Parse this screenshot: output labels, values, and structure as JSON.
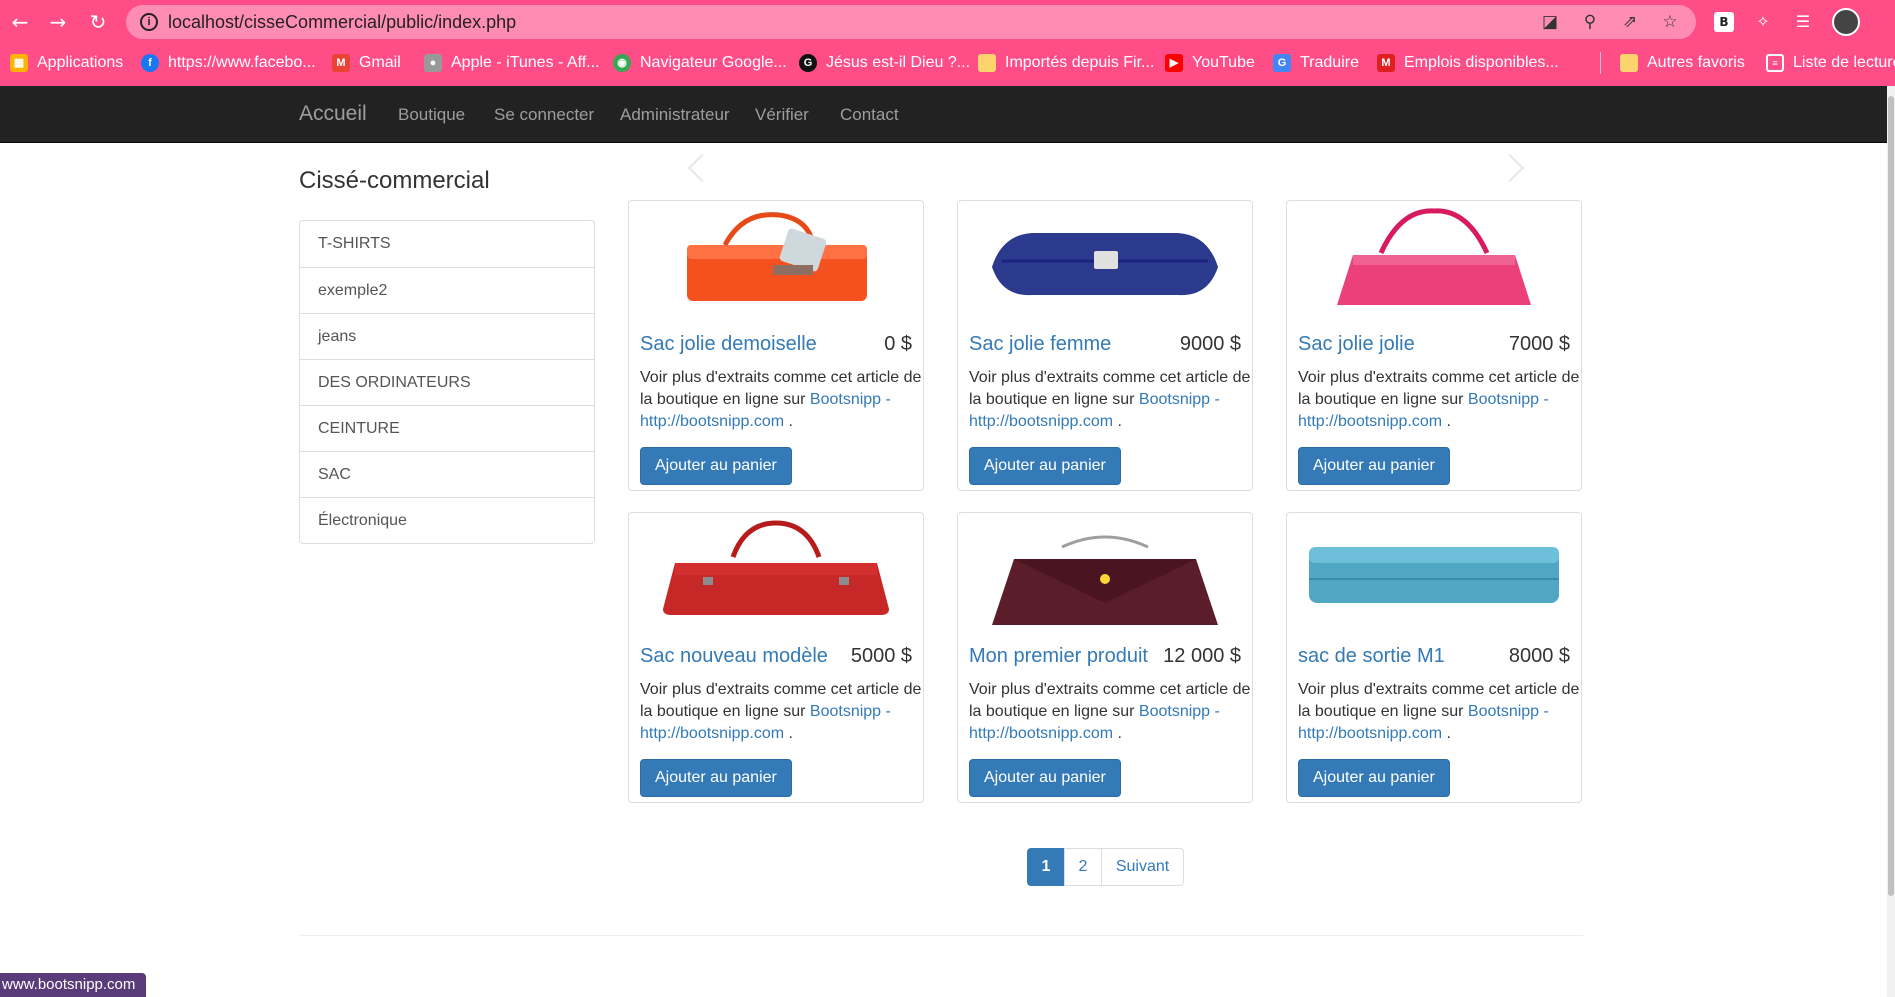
{
  "browser": {
    "url": "localhost/cisseCommercial/public/index.php",
    "bookmarks": [
      {
        "label": "Applications",
        "icon": "apps-grid-icon",
        "color": "#ffb300"
      },
      {
        "label": "https://www.facebo...",
        "icon": "facebook-icon",
        "color": "#1877f2"
      },
      {
        "label": "Gmail",
        "icon": "gmail-icon",
        "color": "#ea4335"
      },
      {
        "label": "Apple - iTunes - Aff...",
        "icon": "apple-icon",
        "color": "#999999"
      },
      {
        "label": "Navigateur Google...",
        "icon": "chrome-icon",
        "color": "#34a853"
      },
      {
        "label": "Jésus est-il Dieu ?...",
        "icon": "g-icon",
        "color": "#111111"
      },
      {
        "label": "Importés depuis Fir...",
        "icon": "folder-icon",
        "color": "#fbd46d"
      },
      {
        "label": "YouTube",
        "icon": "youtube-icon",
        "color": "#ff0000"
      },
      {
        "label": "Traduire",
        "icon": "translate-icon",
        "color": "#4285f4"
      },
      {
        "label": "Emplois disponibles...",
        "icon": "jobs-icon",
        "color": "#e02020"
      },
      {
        "label": "Autres favoris",
        "icon": "folder-icon",
        "color": "#fbd46d"
      },
      {
        "label": "Liste de lecture",
        "icon": "reading-list-icon",
        "color": "#ffffff"
      }
    ],
    "ext_b_label": "B",
    "status_bar_text": "www.bootsnipp.com"
  },
  "navbar": {
    "brand": "Accueil",
    "links": [
      "Boutique",
      "Se connecter",
      "Administrateur",
      "Vérifier",
      "Contact"
    ]
  },
  "sidebar": {
    "title": "Cissé-commercial",
    "categories": [
      "T-SHIRTS",
      "exemple2",
      "jeans",
      "DES ORDINATEURS",
      "CEINTURE",
      "SAC",
      "Électronique"
    ]
  },
  "products": [
    {
      "name": "Sac jolie demoiselle",
      "price": "0 $",
      "image": "orange-handbag",
      "color": "#f4511e"
    },
    {
      "name": "Sac jolie femme",
      "price": "9000 $",
      "image": "navy-clutch",
      "color": "#2b3a8c"
    },
    {
      "name": "Sac jolie jolie",
      "price": "7000 $",
      "image": "pink-tote",
      "color": "#ec407a"
    },
    {
      "name": "Sac nouveau modèle",
      "price": "5000 $",
      "image": "red-satchel",
      "color": "#c62828"
    },
    {
      "name": "Mon premier produit",
      "price": "12 000 $",
      "image": "burgundy-bag",
      "color": "#5b1d2a"
    },
    {
      "name": "sac de sortie M1",
      "price": "8000 $",
      "image": "teal-clutch",
      "color": "#4fa7c4"
    }
  ],
  "product_desc": {
    "text": "Voir plus d'extraits comme cet article de la boutique en ligne sur",
    "link_label": "Bootsnipp - http://bootsnipp.com",
    "suffix": ".",
    "button_label": "Ajouter au panier"
  },
  "pagination": {
    "pages": [
      "1",
      "2"
    ],
    "next_label": "Suivant",
    "active": "1"
  },
  "colors": {
    "chrome": "#ff4d88",
    "navbar": "#222222",
    "primary": "#337ab7"
  }
}
